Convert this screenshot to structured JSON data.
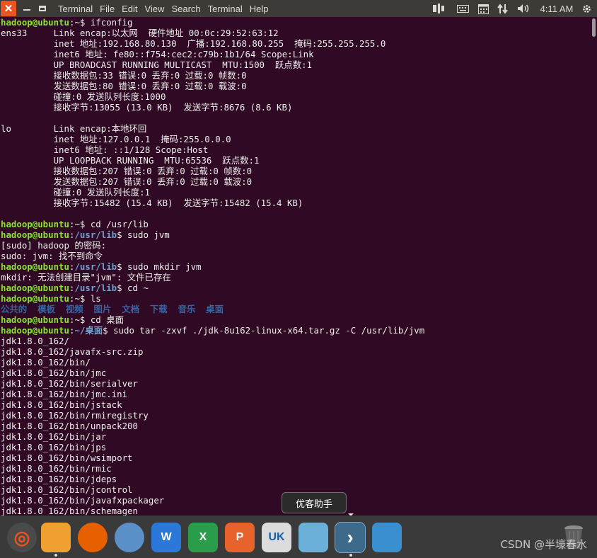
{
  "window": {
    "close_glyph": "✕"
  },
  "menu": [
    "Terminal",
    "File",
    "Edit",
    "View",
    "Search",
    "Terminal",
    "Help"
  ],
  "tray": {
    "clock": "4:11 AM"
  },
  "prompt": {
    "user": "hadoop@ubuntu",
    "dollar": "$"
  },
  "terminal_lines": [
    [
      {
        "t": "hadoop@ubuntu",
        "c": "u"
      },
      {
        "t": ":~$ ifconfig"
      }
    ],
    [
      {
        "t": "ens33     Link encap:以太网  硬件地址 00:0c:29:52:63:12"
      }
    ],
    [
      {
        "t": "          inet 地址:192.168.80.130  广播:192.168.80.255  掩码:255.255.255.0"
      }
    ],
    [
      {
        "t": "          inet6 地址: fe80::f754:cec2:c79b:1b1/64 Scope:Link"
      }
    ],
    [
      {
        "t": "          UP BROADCAST RUNNING MULTICAST  MTU:1500  跃点数:1"
      }
    ],
    [
      {
        "t": "          接收数据包:33 错误:0 丢弃:0 过载:0 帧数:0"
      }
    ],
    [
      {
        "t": "          发送数据包:80 错误:0 丢弃:0 过载:0 载波:0"
      }
    ],
    [
      {
        "t": "          碰撞:0 发送队列长度:1000"
      }
    ],
    [
      {
        "t": "          接收字节:13055 (13.0 KB)  发送字节:8676 (8.6 KB)"
      }
    ],
    [
      {
        "t": ""
      }
    ],
    [
      {
        "t": "lo        Link encap:本地环回"
      }
    ],
    [
      {
        "t": "          inet 地址:127.0.0.1  掩码:255.0.0.0"
      }
    ],
    [
      {
        "t": "          inet6 地址: ::1/128 Scope:Host"
      }
    ],
    [
      {
        "t": "          UP LOOPBACK RUNNING  MTU:65536  跃点数:1"
      }
    ],
    [
      {
        "t": "          接收数据包:207 错误:0 丢弃:0 过载:0 帧数:0"
      }
    ],
    [
      {
        "t": "          发送数据包:207 错误:0 丢弃:0 过载:0 载波:0"
      }
    ],
    [
      {
        "t": "          碰撞:0 发送队列长度:1"
      }
    ],
    [
      {
        "t": "          接收字节:15482 (15.4 KB)  发送字节:15482 (15.4 KB)"
      }
    ],
    [
      {
        "t": ""
      }
    ],
    [
      {
        "t": "hadoop@ubuntu",
        "c": "u"
      },
      {
        "t": ":~$ cd /usr/lib"
      }
    ],
    [
      {
        "t": "hadoop@ubuntu",
        "c": "u"
      },
      {
        "t": ":"
      },
      {
        "t": "/usr/lib",
        "c": "p"
      },
      {
        "t": "$ sudo jvm"
      }
    ],
    [
      {
        "t": "[sudo] hadoop 的密码:"
      }
    ],
    [
      {
        "t": "sudo: jvm: 找不到命令"
      }
    ],
    [
      {
        "t": "hadoop@ubuntu",
        "c": "u"
      },
      {
        "t": ":"
      },
      {
        "t": "/usr/lib",
        "c": "p"
      },
      {
        "t": "$ sudo mkdir jvm"
      }
    ],
    [
      {
        "t": "mkdir: 无法创建目录\"jvm\": 文件已存在"
      }
    ],
    [
      {
        "t": "hadoop@ubuntu",
        "c": "u"
      },
      {
        "t": ":"
      },
      {
        "t": "/usr/lib",
        "c": "p"
      },
      {
        "t": "$ cd ~"
      }
    ],
    [
      {
        "t": "hadoop@ubuntu",
        "c": "u"
      },
      {
        "t": ":~$ ls"
      }
    ],
    [
      {
        "t": "公共的  模板  视频  图片  文档  下载  音乐  桌面",
        "c": "d"
      }
    ],
    [
      {
        "t": "hadoop@ubuntu",
        "c": "u"
      },
      {
        "t": ":~$ cd 桌面"
      }
    ],
    [
      {
        "t": "hadoop@ubuntu",
        "c": "u"
      },
      {
        "t": ":"
      },
      {
        "t": "~/桌面",
        "c": "p"
      },
      {
        "t": "$ sudo tar -zxvf ./jdk-8u162-linux-x64.tar.gz -C /usr/lib/jvm"
      }
    ],
    [
      {
        "t": "jdk1.8.0_162/"
      }
    ],
    [
      {
        "t": "jdk1.8.0_162/javafx-src.zip"
      }
    ],
    [
      {
        "t": "jdk1.8.0_162/bin/"
      }
    ],
    [
      {
        "t": "jdk1.8.0_162/bin/jmc"
      }
    ],
    [
      {
        "t": "jdk1.8.0_162/bin/serialver"
      }
    ],
    [
      {
        "t": "jdk1.8.0_162/bin/jmc.ini"
      }
    ],
    [
      {
        "t": "jdk1.8.0_162/bin/jstack"
      }
    ],
    [
      {
        "t": "jdk1.8.0_162/bin/rmiregistry"
      }
    ],
    [
      {
        "t": "jdk1.8.0_162/bin/unpack200"
      }
    ],
    [
      {
        "t": "jdk1.8.0_162/bin/jar"
      }
    ],
    [
      {
        "t": "jdk1.8.0_162/bin/jps"
      }
    ],
    [
      {
        "t": "jdk1.8.0_162/bin/wsimport"
      }
    ],
    [
      {
        "t": "jdk1.8.0_162/bin/rmic"
      }
    ],
    [
      {
        "t": "jdk1.8.0_162/bin/jdeps"
      }
    ],
    [
      {
        "t": "jdk1.8.0_162/bin/jcontrol"
      }
    ],
    [
      {
        "t": "jdk1.8.0_162/bin/javafxpackager"
      }
    ],
    [
      {
        "t": "jdk1.8.0_162/bin/schemagen"
      }
    ]
  ],
  "dock": {
    "tooltip": "优客助手",
    "items": [
      {
        "name": "ubuntu-software-icon",
        "glyph": "◎",
        "bg": "#4a4a4a"
      },
      {
        "name": "files-folder-icon",
        "glyph": "",
        "bg": "#f0a030"
      },
      {
        "name": "firefox-icon",
        "glyph": "",
        "bg": "#e66000"
      },
      {
        "name": "chromium-icon",
        "glyph": "",
        "bg": "#5b8fc7"
      },
      {
        "name": "wps-writer-icon",
        "glyph": "W",
        "bg": "#2b78d9"
      },
      {
        "name": "wps-spreadsheet-icon",
        "glyph": "X",
        "bg": "#2a9d4a"
      },
      {
        "name": "wps-presentation-icon",
        "glyph": "P",
        "bg": "#e8632b"
      },
      {
        "name": "ubuntu-kylin-uk-icon",
        "glyph": "UK",
        "bg": "#dcdcdc"
      },
      {
        "name": "youker-assistant-icon",
        "glyph": "",
        "bg": "#6ab0d8"
      },
      {
        "name": "terminal-app-icon",
        "glyph": "›",
        "bg": "#3d6a8a"
      },
      {
        "name": "workspace-switcher-icon",
        "glyph": "",
        "bg": "#3a8fd0"
      }
    ],
    "trash_glyph": ""
  },
  "watermark": "CSDN @半壕春水"
}
